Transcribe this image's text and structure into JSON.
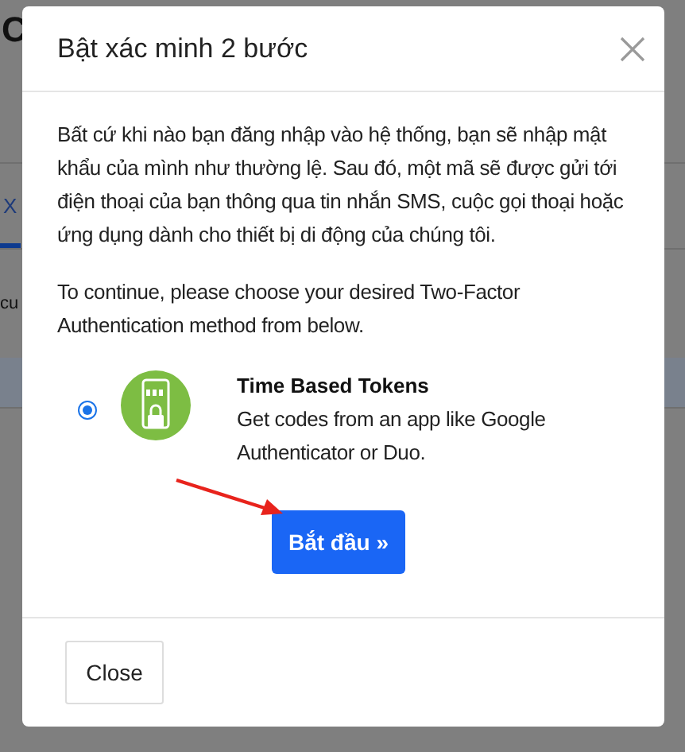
{
  "background": {
    "page_title": "C",
    "tab": "X",
    "text": "cu"
  },
  "dialog": {
    "title": "Bật xác minh 2 bước",
    "intro": "Bất cứ khi nào bạn đăng nhập vào hệ thống, bạn sẽ nhập mật khẩu của mình như thường lệ. Sau đó, một mã sẽ được gửi tới điện thoại của bạn thông qua tin nhắn SMS, cuộc gọi thoại hoặc ứng dụng dành cho thiết bị di động của chúng tôi.",
    "instruction": "To continue, please choose your desired Two-Factor Authentication method from below.",
    "methods": [
      {
        "title": "Time Based Tokens",
        "description": "Get codes from an app like Google Authenticator or Duo.",
        "selected": true
      }
    ],
    "start_button": "Bắt đầu »",
    "close_button": "Close"
  }
}
